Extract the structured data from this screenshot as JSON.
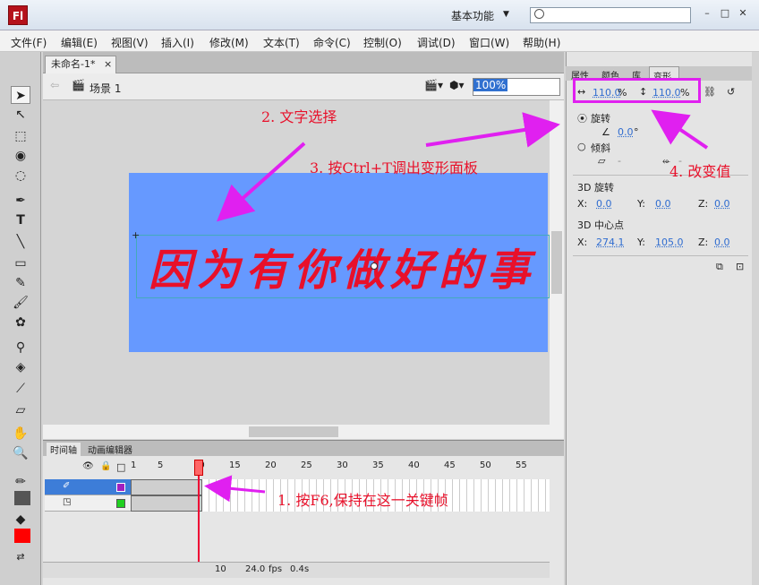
{
  "app": {
    "logo": "Fl",
    "workspace": "基本功能",
    "search_placeholder": "",
    "min": "–",
    "restore": "□",
    "close": "✕"
  },
  "menu": [
    "文件(F)",
    "编辑(E)",
    "视图(V)",
    "插入(I)",
    "修改(M)",
    "文本(T)",
    "命令(C)",
    "控制(O)",
    "调试(D)",
    "窗口(W)",
    "帮助(H)"
  ],
  "doc": {
    "tab_title": "未命名-1*",
    "tab_close": "×",
    "scene": "场景 1",
    "zoom": "100%"
  },
  "stage": {
    "text": "因为有你做好的事",
    "bg_color": "#6699ff",
    "text_color": "#e8102a"
  },
  "timeline": {
    "tabs": [
      "时间轴",
      "动画编辑器"
    ],
    "ruler": [
      "1",
      "5",
      "10",
      "15",
      "20",
      "25",
      "30",
      "35",
      "40",
      "45",
      "50",
      "55"
    ],
    "status": {
      "frame": "10",
      "fps": "24.0",
      "fps_unit": "fps",
      "time": "0.4",
      "time_unit": "s"
    }
  },
  "panel": {
    "tabs": [
      "属性",
      "颜色",
      "库",
      "变形"
    ],
    "scale_w": "110.0",
    "scale_h": "110.0",
    "pct": "%",
    "rotate_label": "旋转",
    "rotate_val": "0.0",
    "deg": "°",
    "skew_label": "倾斜",
    "skew_a": "-",
    "skew_b": "-",
    "rot3d_label": "3D 旋转",
    "x_label": "X:",
    "y_label": "Y:",
    "z_label": "Z:",
    "rot3d_x": "0.0",
    "rot3d_y": "0.0",
    "rot3d_z": "0.0",
    "center_label": "3D 中心点",
    "center_x": "274.1",
    "center_y": "105.0",
    "center_z": "0.0"
  },
  "annotations": {
    "a1": "1. 按F6,保持在这一关键帧",
    "a2": "2. 文字选择",
    "a3": "3. 按Ctrl+T调出变形面板",
    "a4": "4. 改变值",
    "color": "#e020f0"
  }
}
